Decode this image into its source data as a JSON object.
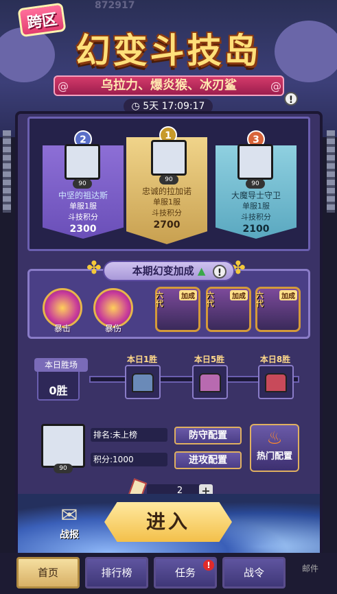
{
  "header": {
    "ghost_counter": "872917",
    "cross_label": "跨区",
    "title": "幻变斗技岛",
    "subtitle": "乌拉力、爆炎猴、冰刃鲨",
    "timer": "5天 17:09:17"
  },
  "podium": [
    {
      "rank": "2",
      "level": "90",
      "name": "中坚的祖达斯",
      "server": "单服1服",
      "score_label": "斗技积分",
      "score": "2300"
    },
    {
      "rank": "1",
      "level": "90",
      "name": "忠诚的拉加诺",
      "server": "单服1服",
      "score_label": "斗技积分",
      "score": "2700"
    },
    {
      "rank": "3",
      "level": "90",
      "name": "大魔导士守卫",
      "server": "单服1服",
      "score_label": "斗技积分",
      "score": "2100"
    }
  ],
  "bonus": {
    "title": "本期幻变加成",
    "skills": [
      {
        "label": "暴击"
      },
      {
        "label": "暴伤"
      }
    ],
    "pets": [
      {
        "tag": "六代",
        "badge": "加成"
      },
      {
        "tag": "六代",
        "badge": "加成"
      },
      {
        "tag": "六代",
        "badge": "加成"
      }
    ]
  },
  "wins": {
    "title": "本日胜场",
    "value": "0胜",
    "milestones": [
      {
        "label": "本日1胜"
      },
      {
        "label": "本日5胜"
      },
      {
        "label": "本日8胜"
      }
    ]
  },
  "player": {
    "level": "90",
    "rank_text": "排名:未上榜",
    "score_text": "积分:1000",
    "defense_btn": "防守配置",
    "attack_btn": "进攻配置",
    "hot_btn": "热门配置"
  },
  "tickets": {
    "count": "2",
    "plus": "+"
  },
  "actions": {
    "enter": "进入",
    "report": "战报"
  },
  "tabs": [
    {
      "label": "首页",
      "active": true
    },
    {
      "label": "排行榜",
      "active": false
    },
    {
      "label": "任务",
      "active": false,
      "badge": "!"
    },
    {
      "label": "战令",
      "active": false
    }
  ],
  "mail": "邮件",
  "colors": {
    "gold": "#f3c04a",
    "purple": "#3a3266",
    "accent": "#d43a6a"
  }
}
